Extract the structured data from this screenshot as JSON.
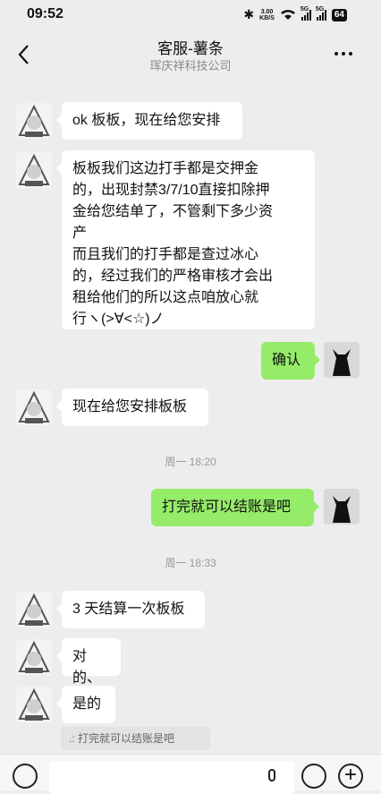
{
  "status": {
    "time": "09:52",
    "net_speed_value": "3.00",
    "net_speed_unit": "KB/S",
    "signal1": "5G",
    "signal2": "5G",
    "battery": "64"
  },
  "header": {
    "title": "客服-薯条",
    "subtitle": "珲庆祥科技公司"
  },
  "messages": {
    "m1": {
      "text": "ok 板板，现在给您安排"
    },
    "m2": {
      "lines": [
        "板板我们这边打手都是交押金",
        "的，出现封禁3/7/10直接扣除押",
        "金给您结单了，不管剩下多少资",
        "产",
        "而且我们的打手都是查过冰心",
        "的，经过我们的严格审核才会出",
        "租给他们的所以这点咱放心就",
        "行ヽ(>∀<☆)ノ"
      ]
    },
    "m3": {
      "text": "确认"
    },
    "m4": {
      "text": "现在给您安排板板"
    },
    "m5": {
      "text": "打完就可以结账是吧"
    },
    "m6": {
      "text": "3 天结算一次板板"
    },
    "m7": {
      "text": "对的、"
    },
    "m8": {
      "text": "是的"
    }
  },
  "timestamps": {
    "t1": "周一 18:20",
    "t2": "周一 18:33"
  },
  "quote": {
    "text": ".: 打完就可以结账是吧"
  },
  "colors": {
    "background": "#ededed",
    "bubble_self": "#95ec69",
    "bubble_other": "#ffffff",
    "timestamp": "#999999"
  },
  "icons": {
    "back": "chevron-left",
    "more": "ellipsis",
    "voice": "voice-wave",
    "emoji": "smile",
    "plus": "plus",
    "mic": "microphone"
  }
}
